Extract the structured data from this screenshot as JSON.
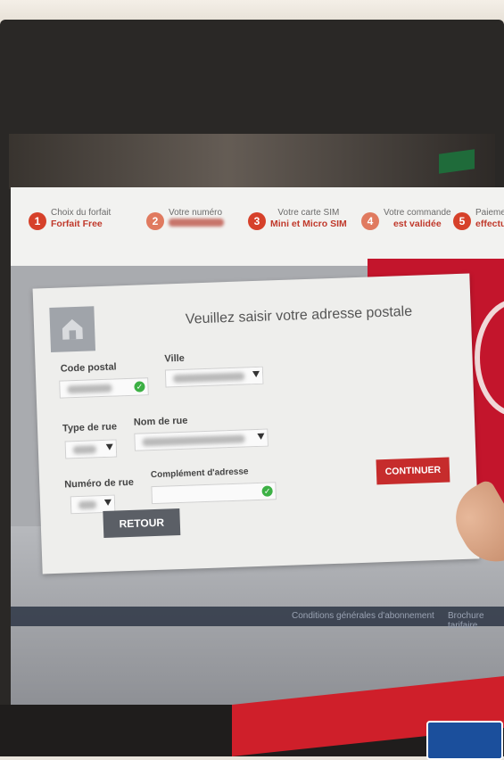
{
  "steps": [
    {
      "num": "1",
      "title": "Choix du forfait",
      "sub": "Forfait Free"
    },
    {
      "num": "2",
      "title": "Votre numéro",
      "sub": ""
    },
    {
      "num": "3",
      "title": "Votre carte SIM",
      "sub": "Mini et Micro SIM"
    },
    {
      "num": "4",
      "title": "Votre commande",
      "sub": "est validée"
    },
    {
      "num": "5",
      "title": "Paiement",
      "sub": "effectué"
    }
  ],
  "dialog": {
    "title": "Veuillez saisir votre adresse postale",
    "labels": {
      "code_postal": "Code postal",
      "ville": "Ville",
      "type_rue": "Type de rue",
      "nom_rue": "Nom de rue",
      "numero_rue": "Numéro de rue",
      "complement": "Complément d'adresse"
    },
    "continue_label": "CONTINUER",
    "back_label": "RETOUR"
  },
  "footer": {
    "conditions": "Conditions générales d'abonnement",
    "brochure": "Brochure tarifaire"
  },
  "colors": {
    "accent": "#c62c2c",
    "valid": "#3cb044",
    "panel": "#eeeeec"
  },
  "icons": {
    "home": "home-icon",
    "valid": "check-circle-icon",
    "dropdown": "chevron-down-icon"
  }
}
